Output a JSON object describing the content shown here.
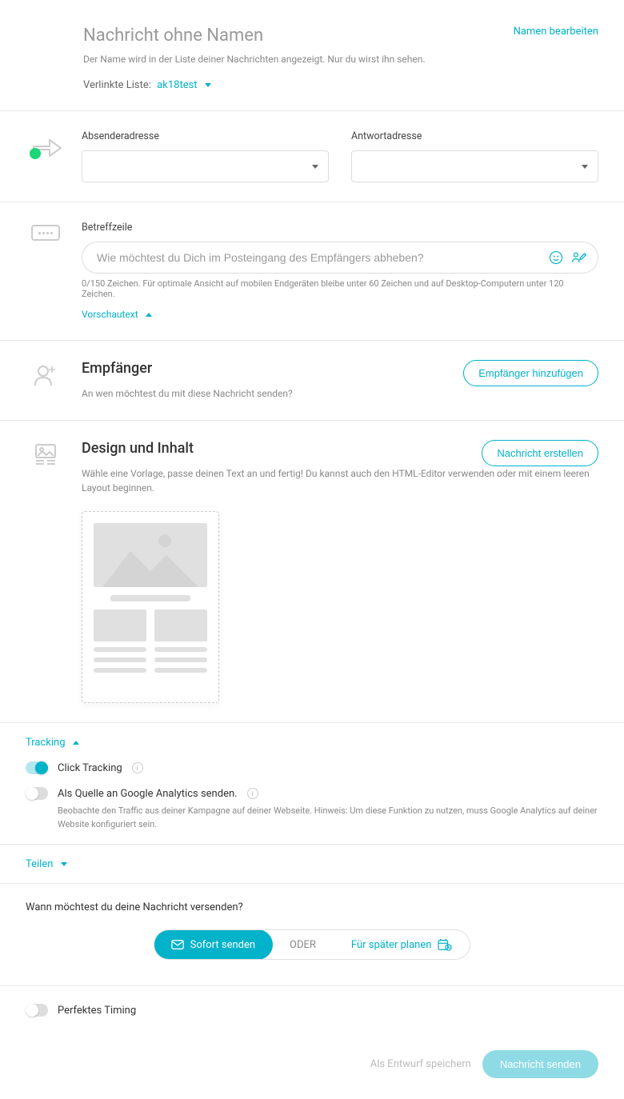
{
  "header": {
    "title": "Nachricht ohne Namen",
    "edit_name": "Namen bearbeiten",
    "desc": "Der Name wird in der Liste deiner Nachrichten angezeigt. Nur du wirst ihn sehen.",
    "linked_label": "Verlinkte Liste:",
    "linked_value": "ak18test"
  },
  "addresses": {
    "sender_label": "Absenderadresse",
    "reply_label": "Antwortadresse"
  },
  "subject": {
    "label": "Betreffzeile",
    "placeholder": "Wie möchtest du Dich im Posteingang des Empfängers abheben?",
    "hint": "0/150 Zeichen. Für optimale Ansicht auf mobilen Endgeräten bleibe unter 60 Zeichen und auf Desktop-Computern unter 120 Zeichen.",
    "preview_link": "Vorschautext"
  },
  "recipients": {
    "title": "Empfänger",
    "add_btn": "Empfänger hinzufügen",
    "desc": "An wen möchtest du mit diese Nachricht senden?"
  },
  "design": {
    "title": "Design und Inhalt",
    "create_btn": "Nachricht erstellen",
    "desc": "Wähle eine Vorlage, passe deinen Text an und fertig! Du kannst auch den HTML-Editor verwenden oder mit einem leeren Layout beginnen."
  },
  "tracking": {
    "header": "Tracking",
    "click_label": "Click Tracking",
    "ga_label": "Als Quelle an Google Analytics senden.",
    "ga_desc": "Beobachte den Traffic aus deiner Kampagne auf deiner Webseite. Hinweis: Um diese Funktion zu nutzen, muss Google Analytics auf deiner Website konfiguriert sein."
  },
  "share": {
    "header": "Teilen"
  },
  "send": {
    "question": "Wann möchtest du deine Nachricht versenden?",
    "now": "Sofort senden",
    "or": "ODER",
    "later": "Für später planen"
  },
  "timing": {
    "label": "Perfektes Timing"
  },
  "footer": {
    "draft": "Als Entwurf speichern",
    "send": "Nachricht senden"
  }
}
